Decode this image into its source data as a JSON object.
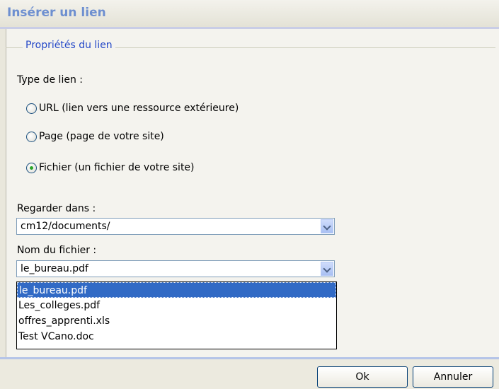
{
  "dialog": {
    "title": "Insérer un lien",
    "legend": "Propriétés du lien",
    "link_type_label": "Type de lien :",
    "radios": [
      {
        "label": "URL (lien vers une ressource extérieure)",
        "checked": false
      },
      {
        "label": "Page (page de votre site)",
        "checked": false
      },
      {
        "label": "Fichier (un fichier de votre site)",
        "checked": true
      }
    ],
    "look_in_label": "Regarder dans :",
    "look_in_value": "cm12/documents/",
    "file_name_label": "Nom du fichier :",
    "file_name_value": "le_bureau.pdf",
    "file_options": [
      "le_bureau.pdf",
      "Les_colleges.pdf",
      "offres_apprenti.xls",
      "Test VCano.doc"
    ],
    "ok_label": "Ok",
    "cancel_label": "Annuler"
  }
}
